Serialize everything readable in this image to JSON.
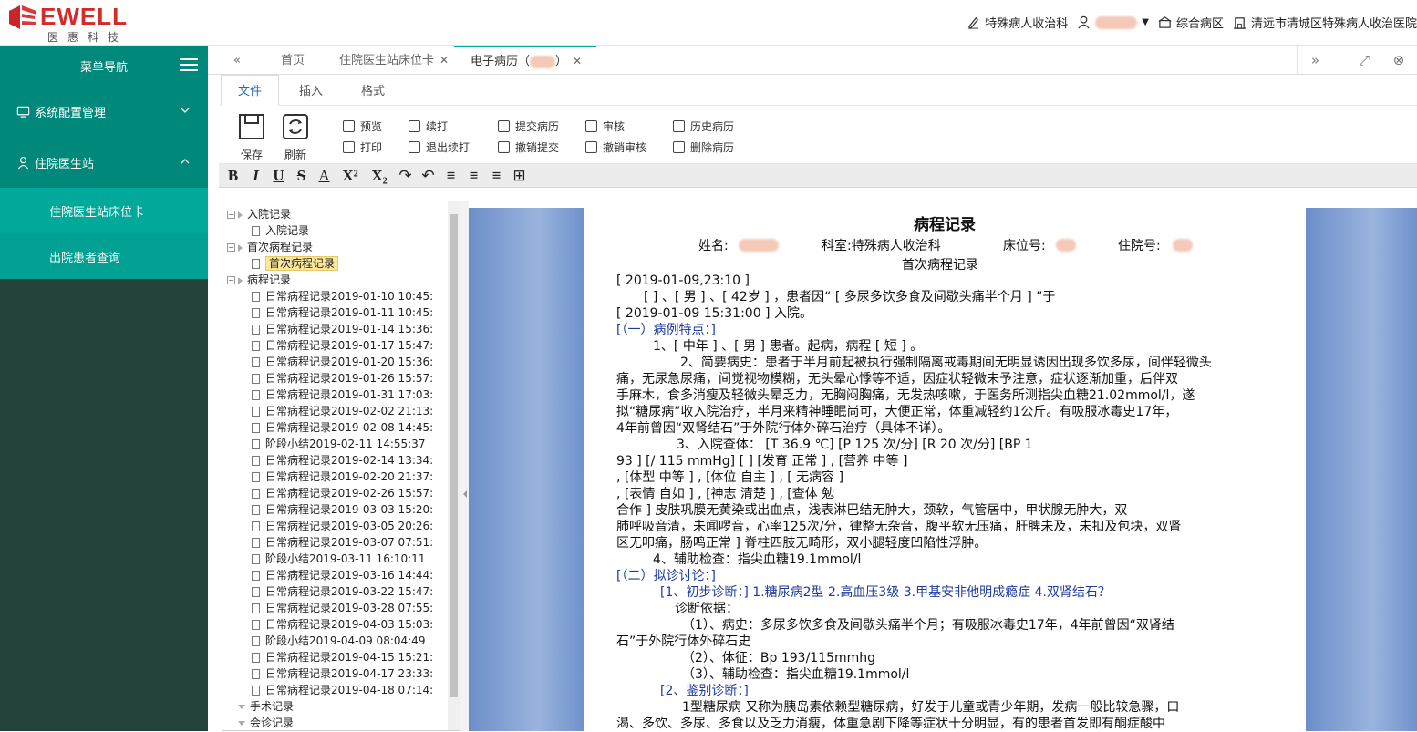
{
  "header": {
    "logo_text": "EWELL",
    "logo_sub": "医惠科技",
    "dept": "特殊病人收治科",
    "ward": "综合病区",
    "hospital": "清远市清城区特殊病人收治医院"
  },
  "sidebar": {
    "title": "菜单导航",
    "groups": [
      {
        "label": "系统配置管理"
      },
      {
        "label": "住院医生站"
      }
    ],
    "subitems": [
      {
        "label": "住院医生站床位卡"
      },
      {
        "label": "出院患者查询"
      }
    ]
  },
  "tabs": {
    "items": [
      {
        "label": "首页"
      },
      {
        "label": "住院医生站床位卡"
      },
      {
        "label": "电子病历（"
      },
      {
        "label": "）"
      }
    ],
    "prev": "«",
    "next": "»"
  },
  "ribbon": {
    "tabs": [
      "文件",
      "插入",
      "格式"
    ],
    "save": "保存",
    "refresh": "刷新",
    "preview": "预览",
    "print": "打印",
    "continue_print": "续打",
    "exit_continue_print": "退出续打",
    "submit": "提交病历",
    "revoke_submit": "撤销提交",
    "review": "审核",
    "revoke_review": "撤销审核",
    "history": "历史病历",
    "delete": "删除病历"
  },
  "fmt": {
    "bold": "B",
    "italic": "I",
    "underline": "U",
    "strike": "S",
    "fontcolor": "A",
    "sup": "X²",
    "sub": "X₂",
    "redo": "↷",
    "undo": "↶",
    "align_left": "≡",
    "align_center": "≡",
    "align_right": "≡",
    "table": "⊞"
  },
  "tree": {
    "items": [
      {
        "label": "入院记录"
      },
      {
        "label": "入院记录"
      },
      {
        "label": "首次病程记录"
      },
      {
        "label": "首次病程记录"
      },
      {
        "label": "病程记录"
      },
      {
        "label": "日常病程记录2019-01-10 10:45:"
      },
      {
        "label": "日常病程记录2019-01-11 10:45:"
      },
      {
        "label": "日常病程记录2019-01-14 15:36:"
      },
      {
        "label": "日常病程记录2019-01-17 15:47:"
      },
      {
        "label": "日常病程记录2019-01-20 15:36:"
      },
      {
        "label": "日常病程记录2019-01-26 15:57:"
      },
      {
        "label": "日常病程记录2019-01-31 17:03:"
      },
      {
        "label": "日常病程记录2019-02-02 21:13:"
      },
      {
        "label": "日常病程记录2019-02-08 14:45:"
      },
      {
        "label": "阶段小结2019-02-11 14:55:37"
      },
      {
        "label": "日常病程记录2019-02-14 13:34:"
      },
      {
        "label": "日常病程记录2019-02-20 21:37:"
      },
      {
        "label": "日常病程记录2019-02-26 15:57:"
      },
      {
        "label": "日常病程记录2019-03-03 15:20:"
      },
      {
        "label": "日常病程记录2019-03-05 20:26:"
      },
      {
        "label": "日常病程记录2019-03-07 07:51:"
      },
      {
        "label": "阶段小结2019-03-11 16:10:11"
      },
      {
        "label": "日常病程记录2019-03-16 14:44:"
      },
      {
        "label": "日常病程记录2019-03-22 15:47:"
      },
      {
        "label": "日常病程记录2019-03-28 07:55:"
      },
      {
        "label": "日常病程记录2019-04-03 15:03:"
      },
      {
        "label": "阶段小结2019-04-09 08:04:49"
      },
      {
        "label": "日常病程记录2019-04-15 15:21:"
      },
      {
        "label": "日常病程记录2019-04-17 23:33:"
      },
      {
        "label": "日常病程记录2019-04-18 07:14:"
      },
      {
        "label": "手术记录"
      },
      {
        "label": "会诊记录"
      }
    ]
  },
  "doc": {
    "title": "病程记录",
    "name_label": "姓名:",
    "dept_label": "科室:特殊病人收治科",
    "bed_label": "床位号:",
    "inpatient_label": "住院号:",
    "subtitle": "首次病程记录",
    "lines": [
      "[ 2019-01-09,23:10 ]",
      "[      ] 、[ 男 ] 、[ 42岁 ] ，患者因“ [   多尿多饮多食及间歇头痛半个月   ] ”于",
      "[ 2019-01-09 15:31:00 ] 入院。",
      "[（一）病例特点：]",
      "1、[ 中年 ] 、[ 男 ] 患者。起病，病程 [ 短 ] 。",
      "2、简要病史：患者于半月前起被执行强制隔离戒毒期间无明显诱因出现多饮多尿，间伴轻微头",
      "痛，无尿急尿痛，间觉视物模糊，无头晕心悸等不适，因症状轻微未予注意，症状逐渐加重，后伴双",
      "手麻木，食多消瘦及轻微头晕乏力，无胸闷胸痛，无发热咳嗽，于医务所测指尖血糖21.02mmol/l，遂",
      "拟“糖尿病”收入院治疗，半月来精神睡眠尚可，大便正常，体重减轻约1公斤。有吸服冰毒史17年，",
      "4年前曾因“双肾结石”于外院行体外碎石治疗（具体不详）。",
      "3、入院查体：  [T 36.9 ℃]         [P 125 次/分]          [R 20 次/分]          [BP 1",
      "93 ]    [/ 115 mmHg]     [         ]        [发育       正常      ]       ,      [营养       中等      ]",
      "    ,       [体型       中等       ]        ,        [体位  自主       ]          ,       [       无病容        ]",
      "    ,       [表情       自如       ]        ,        [神志       清楚       ]          ,       [查体          勉",
      "合作      ]        皮肤巩膜无黄染或出血点，浅表淋巴结无肿大，颈软，气管居中，甲状腺无肿大，双",
      "肺呼吸音清，未闻啰音，心率125次/分，律整无杂音，腹平软无压痛，肝脾未及，未扣及包块，双肾",
      "区无叩痛，肠鸣正常    ]    脊柱四肢无畸形，双小腿轻度凹陷性浮肿。",
      "4、辅助检查：指尖血糖19.1mmol/l",
      "[（二）拟诊讨论：]",
      "[1、初步诊断：] 1.糖尿病2型 2.高血压3级    3.甲基安非他明成瘾症 4.双肾结石？",
      "诊断依据：",
      "（1）、病史：多尿多饮多食及间歇头痛半个月；有吸服冰毒史17年，4年前曾因“双肾结",
      "石”于外院行体外碎石史",
      "（2）、体征：Bp 193/115mmhg",
      "（3）、辅助检查：指尖血糖19.1mmol/l",
      "[2、鉴别诊断：]",
      "1型糖尿病 又称为胰岛素依赖型糖尿病，好发于儿童或青少年期，发病一般比较急骤，口",
      "渴、多饮、多尿、多食以及乏力消瘦，体重急剧下降等症状十分明显，有的患者首发即有酮症酸中"
    ]
  }
}
